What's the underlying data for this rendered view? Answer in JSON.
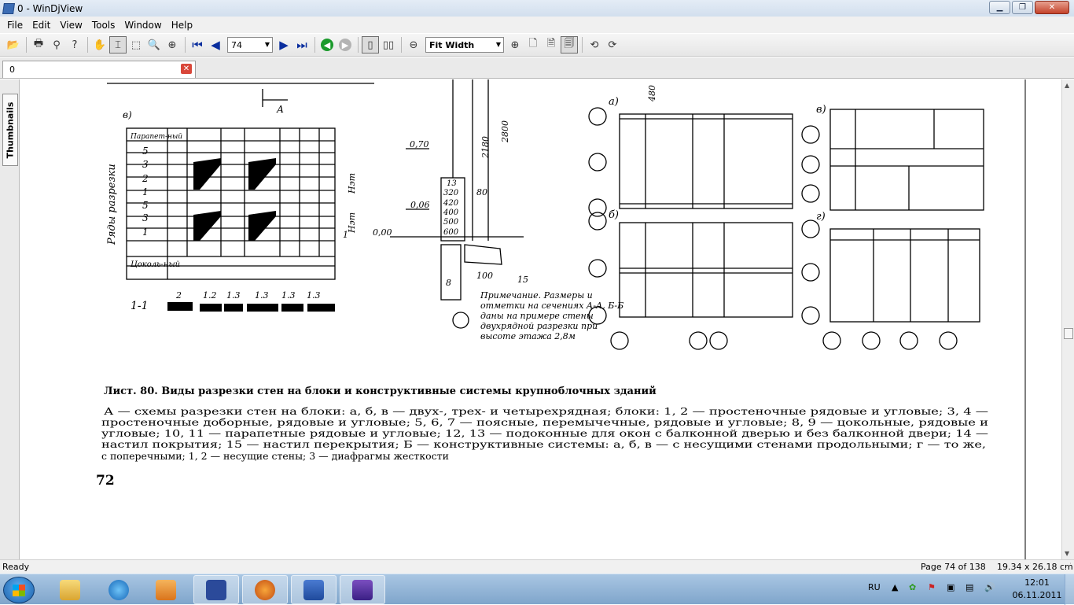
{
  "window": {
    "title": "0 - WinDjView",
    "min": "▁",
    "max": "❐",
    "close": "✕"
  },
  "menu": [
    "File",
    "Edit",
    "View",
    "Tools",
    "Window",
    "Help"
  ],
  "toolbar": {
    "page_number": "74",
    "zoom": "Fit Width"
  },
  "tabs": [
    {
      "label": "0"
    }
  ],
  "sidebar": {
    "thumbnails_label": "Thumbnails"
  },
  "document": {
    "section_a_label": "в)",
    "section_b_label": "а)",
    "section_c_label": "б)",
    "section_d_label": "в)",
    "section_e_label": "г)",
    "row_labels": [
      "Парапет-ный",
      "5",
      "3",
      "2",
      "1",
      "5",
      "3",
      "1",
      "Цоколь-ный"
    ],
    "axis_label": "Ряды разрезки",
    "height_label_1": "Нэт",
    "height_label_2": "Нэт",
    "section_mark": "А",
    "scale_label": "1-1",
    "scale_values": [
      "2",
      "1.2",
      "1.3",
      "1.3",
      "1.3",
      "1.3"
    ],
    "dims": [
      "480",
      "2800",
      "2180",
      "0,70",
      "0,06",
      "0,00",
      "80",
      "100",
      "15",
      "8",
      "1",
      "13",
      "320",
      "420",
      "400",
      "500",
      "600"
    ],
    "note": "Примечание. Размеры и отметки на сечениях А-А, Б-Б даны на примере стены двухрядной разрезки при высоте этажа 2,8м",
    "caption_title": "Лист. 80. Виды разрезки стен на блоки и конструктивные системы крупноблочных зданий",
    "caption_lines": [
      "А — схемы разрезки стен на блоки: а, б, в — двух-, трех- и четырехрядная; блоки: 1, 2 — простеночные рядовые и угловые; 3, 4 —",
      "простеночные доборные, рядовые и угловые; 5, 6, 7 — поясные, перемычечные, рядовые и угловые; 8, 9 — цокольные, рядовые и",
      "угловые; 10, 11 — парапетные рядовые и угловые; 12, 13 — подоконные для окон с балконной дверью и без балконной двери; 14 —",
      "настил покрытия; 15 — настил перекрытия; Б — конструктивные системы: а, б, в — с несущими стенами продольными; г — то же,",
      "с поперечными; 1, 2 — несущие стены; 3 — диафрагмы жесткости"
    ],
    "page_number": "72"
  },
  "status": {
    "left": "Ready",
    "page": "Page 74 of 138",
    "size": "19.34 x 26.18 cm"
  },
  "taskbar": {
    "lang": "RU",
    "time": "12:01",
    "date": "06.11.2011"
  }
}
